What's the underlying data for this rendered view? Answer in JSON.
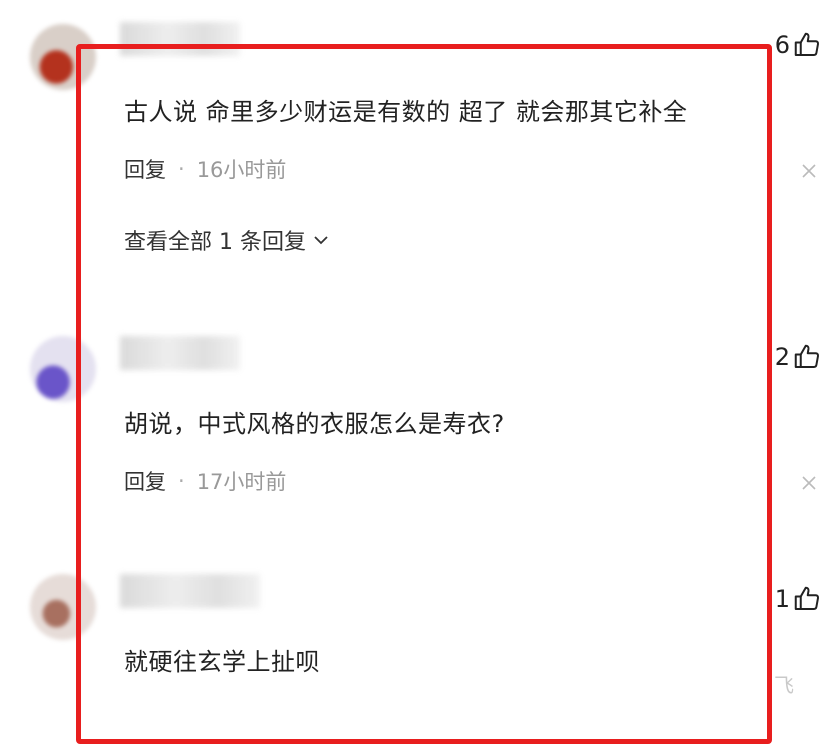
{
  "comments": [
    {
      "text": "古人说 命里多少财运是有数的 超了 就会那其它补全",
      "like_count": "6",
      "reply_label": "回复",
      "separator": "·",
      "time": "16小时前",
      "view_replies": "查看全部 1 条回复"
    },
    {
      "text": "胡说，中式风格的衣服怎么是寿衣?",
      "like_count": "2",
      "reply_label": "回复",
      "separator": "·",
      "time": "17小时前"
    },
    {
      "text": "就硬往玄学上扯呗",
      "like_count": "1"
    }
  ],
  "corner_text": "飞",
  "colors": {
    "highlight": "#e81e1e"
  }
}
